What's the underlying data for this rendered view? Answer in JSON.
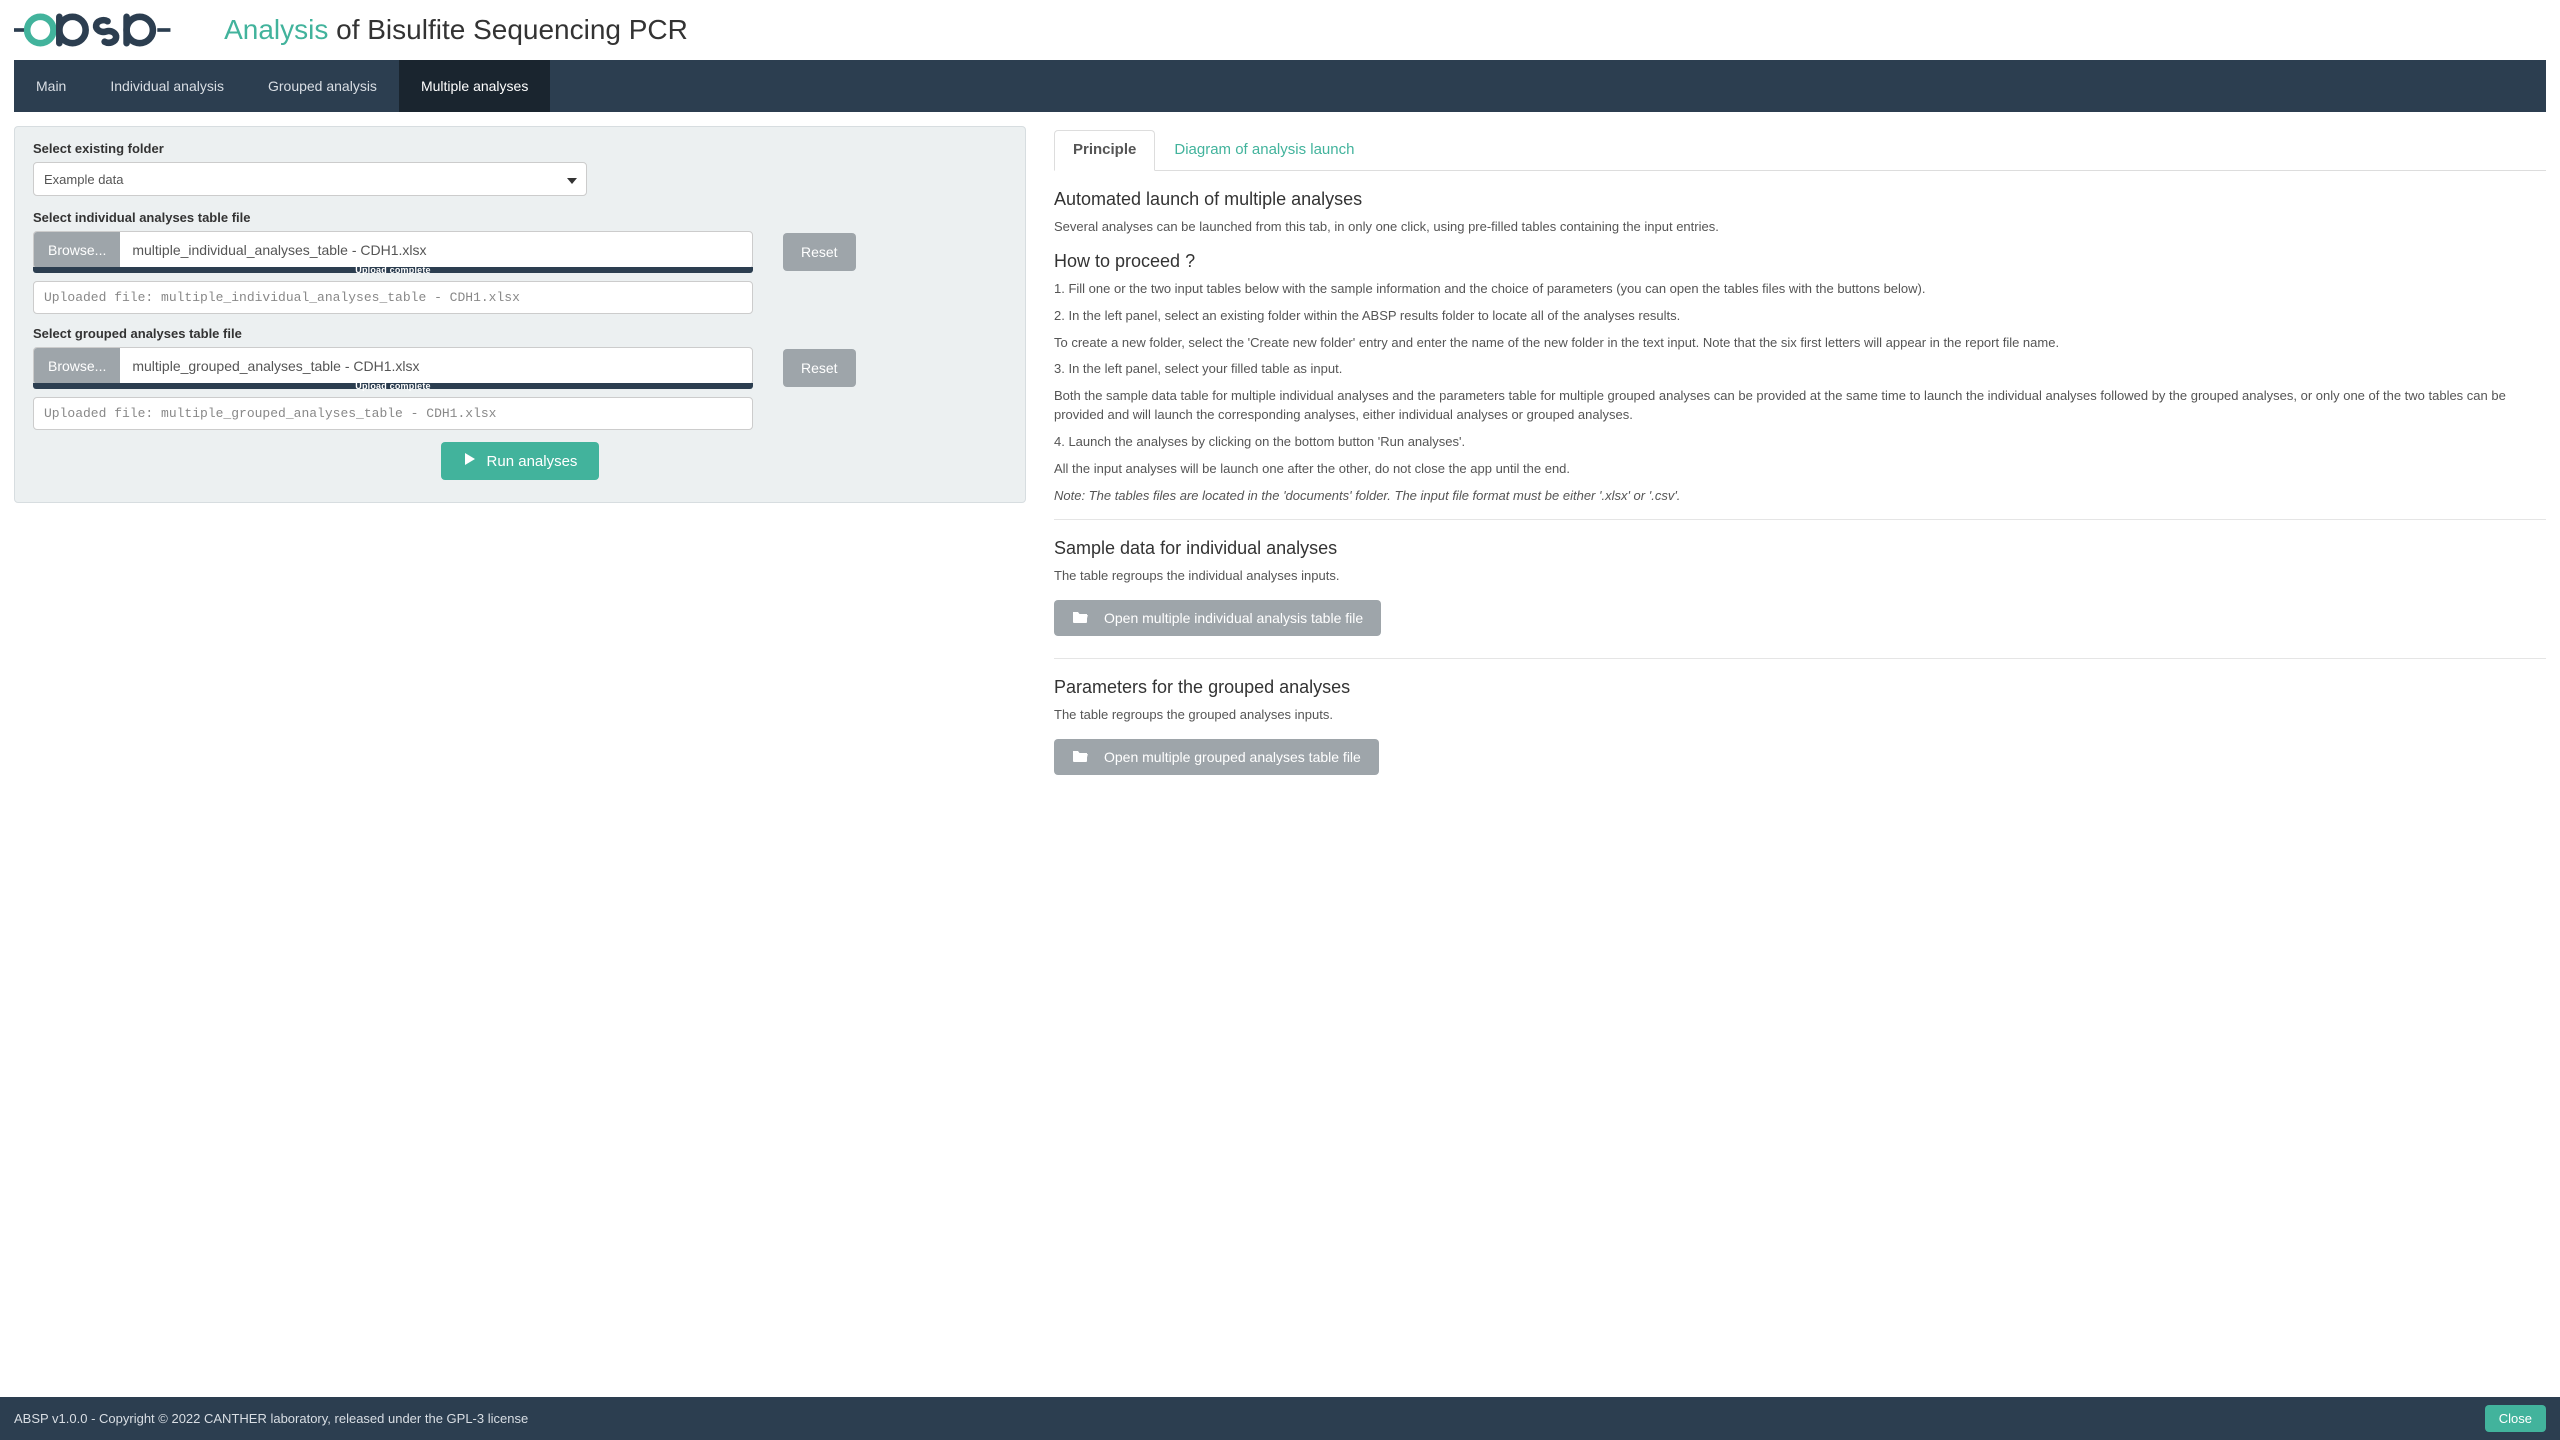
{
  "header": {
    "title_prefix": "Analysis",
    "title_rest": " of Bisulfite Sequencing PCR"
  },
  "nav": {
    "items": [
      {
        "label": "Main"
      },
      {
        "label": "Individual analysis"
      },
      {
        "label": "Grouped analysis"
      },
      {
        "label": "Multiple analyses"
      }
    ],
    "active_index": 3
  },
  "left": {
    "folder_label": "Select existing folder",
    "folder_value": "Example data",
    "ind_label": "Select individual analyses table file",
    "browse_label": "Browse...",
    "ind_filename": "multiple_individual_analyses_table - CDH1.xlsx",
    "reset_label": "Reset",
    "upload_complete": "Upload complete",
    "ind_uploaded_msg": "Uploaded file: multiple_individual_analyses_table - CDH1.xlsx",
    "grp_label": "Select grouped analyses table file",
    "grp_filename": "multiple_grouped_analyses_table - CDH1.xlsx",
    "grp_uploaded_msg": "Uploaded file: multiple_grouped_analyses_table - CDH1.xlsx",
    "run_label": "Run analyses"
  },
  "right": {
    "tabs": [
      {
        "label": "Principle"
      },
      {
        "label": "Diagram of analysis launch"
      }
    ],
    "active_tab": 0,
    "h1": "Automated launch of multiple analyses",
    "p1": "Several analyses can be launched from this tab, in only one click, using pre-filled tables containing the input entries.",
    "h2": "How to proceed ?",
    "step1": "1. Fill one or the two input tables below with the sample information and the choice of parameters (you can open the tables files with the buttons below).",
    "step2": "2. In the left panel, select an existing folder within the ABSP results folder to locate all of the analyses results.",
    "step2b": "To create a new folder, select the 'Create new folder' entry and enter the name of the new folder in the text input. Note that the six first letters will appear in the report file name.",
    "step3": "3. In the left panel, select your filled table as input.",
    "step3b": "Both the sample data table for multiple individual analyses and the parameters table for multiple grouped analyses can be provided at the same time to launch the individual analyses followed by the grouped analyses, or only one of the two tables can be provided and will launch the corresponding analyses, either individual analyses or grouped analyses.",
    "step4": "4. Launch the analyses by clicking on the bottom button 'Run analyses'.",
    "step4b": "All the input analyses will be launch one after the other, do not close the app until the end.",
    "note": "Note: The tables files are located in the 'documents' folder. The input file format must be either '.xlsx' or '.csv'.",
    "h3": "Sample data for individual analyses",
    "p3": "The table regroups the individual analyses inputs.",
    "btn_ind": "Open multiple individual analysis table file",
    "h4": "Parameters for the grouped analyses",
    "p4": "The table regroups the grouped analyses inputs.",
    "btn_grp": "Open multiple grouped analyses table file"
  },
  "footer": {
    "text": "ABSP v1.0.0 - Copyright © 2022 CANTHER laboratory, released under the GPL-3 license",
    "close": "Close"
  }
}
